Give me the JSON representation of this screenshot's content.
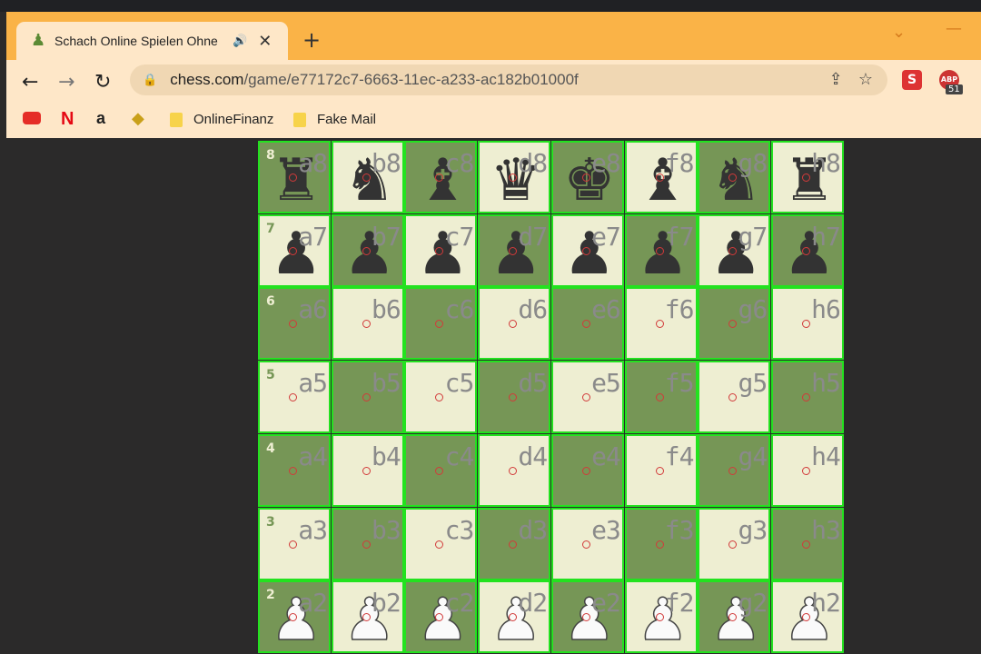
{
  "browser": {
    "tab_title": "Schach Online Spielen Ohne",
    "url_domain": "chess.com",
    "url_path": "/game/e77172c7-6663-11ec-a233-ac182b01000f",
    "extension_badge": "51",
    "extension_badge_top": "ABP",
    "bookmarks": [
      "OnlineFinanz",
      "Fake Mail"
    ]
  },
  "board": {
    "ranks_shown": [
      "8",
      "7",
      "6",
      "5",
      "4",
      "3",
      "2"
    ],
    "files": [
      "a",
      "b",
      "c",
      "d",
      "e",
      "f",
      "g",
      "h"
    ],
    "pieces": {
      "a8": "♜",
      "b8": "♞",
      "c8": "♝",
      "d8": "♛",
      "e8": "♚",
      "f8": "♝",
      "g8": "♞",
      "h8": "♜",
      "a7": "♟",
      "b7": "♟",
      "c7": "♟",
      "d7": "♟",
      "e7": "♟",
      "f7": "♟",
      "g7": "♟",
      "h7": "♟",
      "a2": "♟",
      "b2": "♟",
      "c2": "♟",
      "d2": "♟",
      "e2": "♟",
      "f2": "♟",
      "g2": "♟",
      "h2": "♟"
    },
    "white_ranks": [
      "2"
    ],
    "colors": {
      "light": "#eeeed2",
      "dark": "#769656",
      "grid": "#23e21f",
      "marker": "#d23a3a"
    }
  }
}
